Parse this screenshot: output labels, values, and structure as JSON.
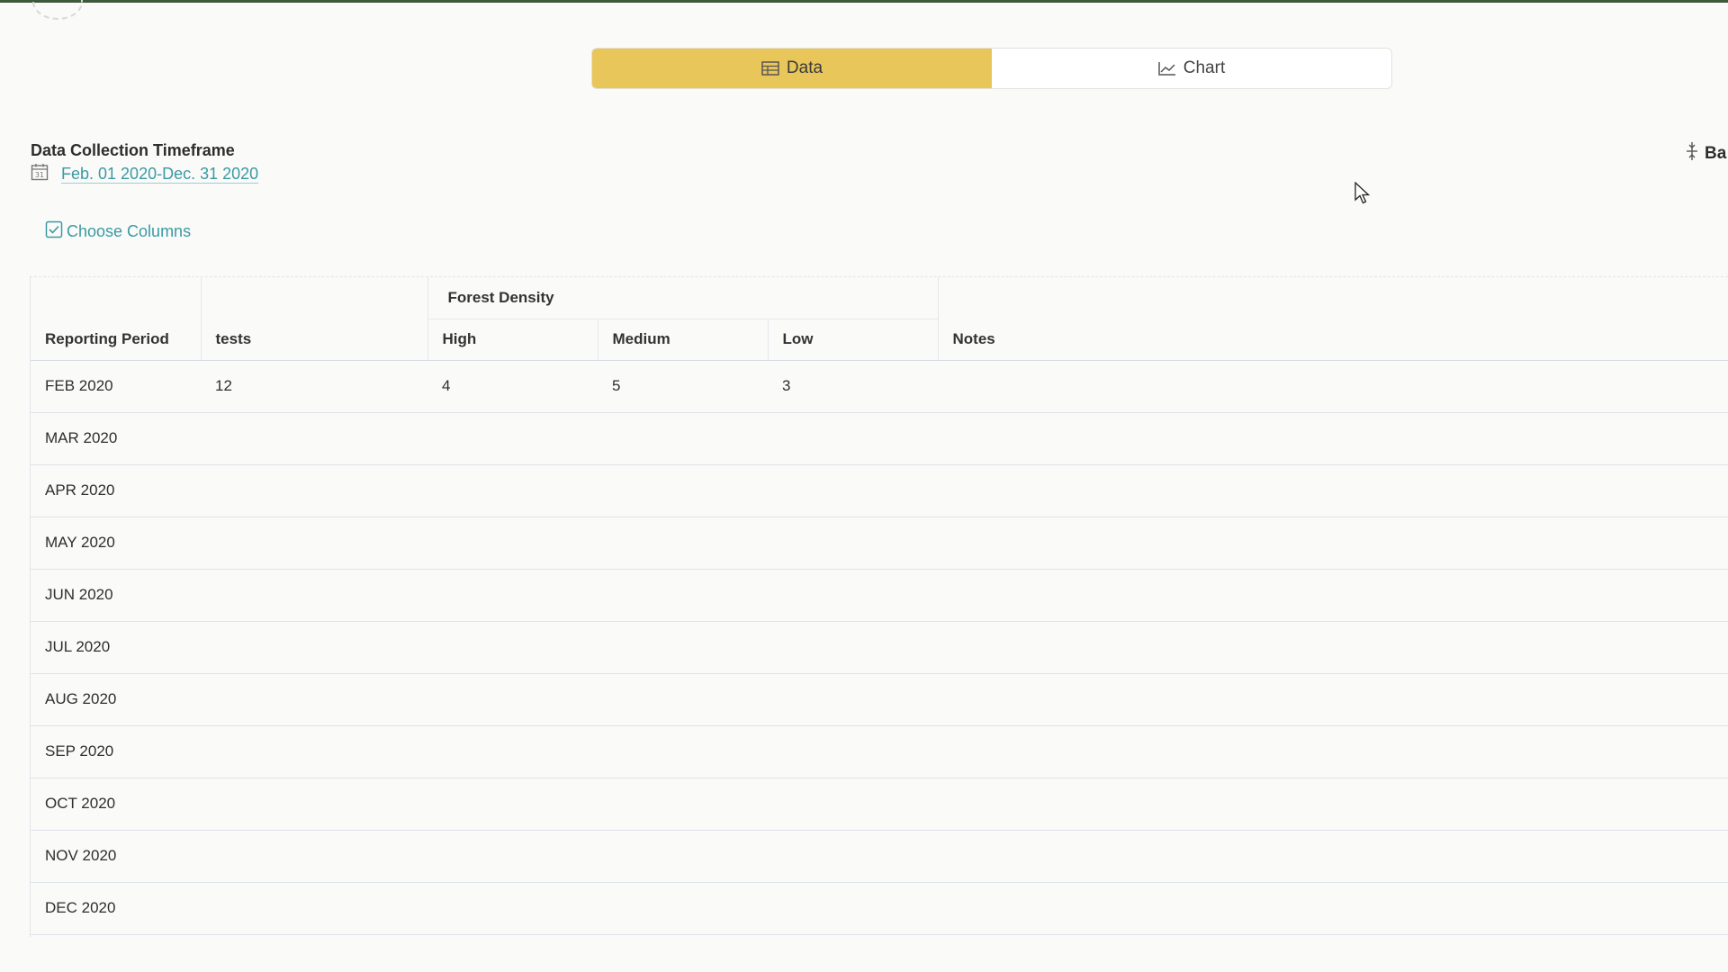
{
  "view_toggle": {
    "data_label": "Data",
    "chart_label": "Chart",
    "active": "Data",
    "accent_color": "#e9c65a"
  },
  "timeframe": {
    "title": "Data Collection Timeframe",
    "range": "Feb. 01 2020-Dec. 31 2020",
    "icon": "calendar-icon"
  },
  "right_action": {
    "label": "Ba",
    "icon": "collapse-icon"
  },
  "choose_columns": {
    "label": "Choose Columns",
    "icon": "checkbox-icon"
  },
  "table": {
    "headers": {
      "period": "Reporting Period",
      "tests": "tests",
      "group": "Forest Density",
      "high": "High",
      "medium": "Medium",
      "low": "Low",
      "notes": "Notes"
    },
    "rows": [
      {
        "period": "FEB 2020",
        "tests": "12",
        "high": "4",
        "medium": "5",
        "low": "3",
        "notes": ""
      },
      {
        "period": "MAR 2020",
        "tests": "",
        "high": "",
        "medium": "",
        "low": "",
        "notes": ""
      },
      {
        "period": "APR 2020",
        "tests": "",
        "high": "",
        "medium": "",
        "low": "",
        "notes": ""
      },
      {
        "period": "MAY 2020",
        "tests": "",
        "high": "",
        "medium": "",
        "low": "",
        "notes": ""
      },
      {
        "period": "JUN 2020",
        "tests": "",
        "high": "",
        "medium": "",
        "low": "",
        "notes": ""
      },
      {
        "period": "JUL 2020",
        "tests": "",
        "high": "",
        "medium": "",
        "low": "",
        "notes": ""
      },
      {
        "period": "AUG 2020",
        "tests": "",
        "high": "",
        "medium": "",
        "low": "",
        "notes": ""
      },
      {
        "period": "SEP 2020",
        "tests": "",
        "high": "",
        "medium": "",
        "low": "",
        "notes": ""
      },
      {
        "period": "OCT 2020",
        "tests": "",
        "high": "",
        "medium": "",
        "low": "",
        "notes": ""
      },
      {
        "period": "NOV 2020",
        "tests": "",
        "high": "",
        "medium": "",
        "low": "",
        "notes": ""
      },
      {
        "period": "DEC 2020",
        "tests": "",
        "high": "",
        "medium": "",
        "low": "",
        "notes": ""
      }
    ]
  }
}
